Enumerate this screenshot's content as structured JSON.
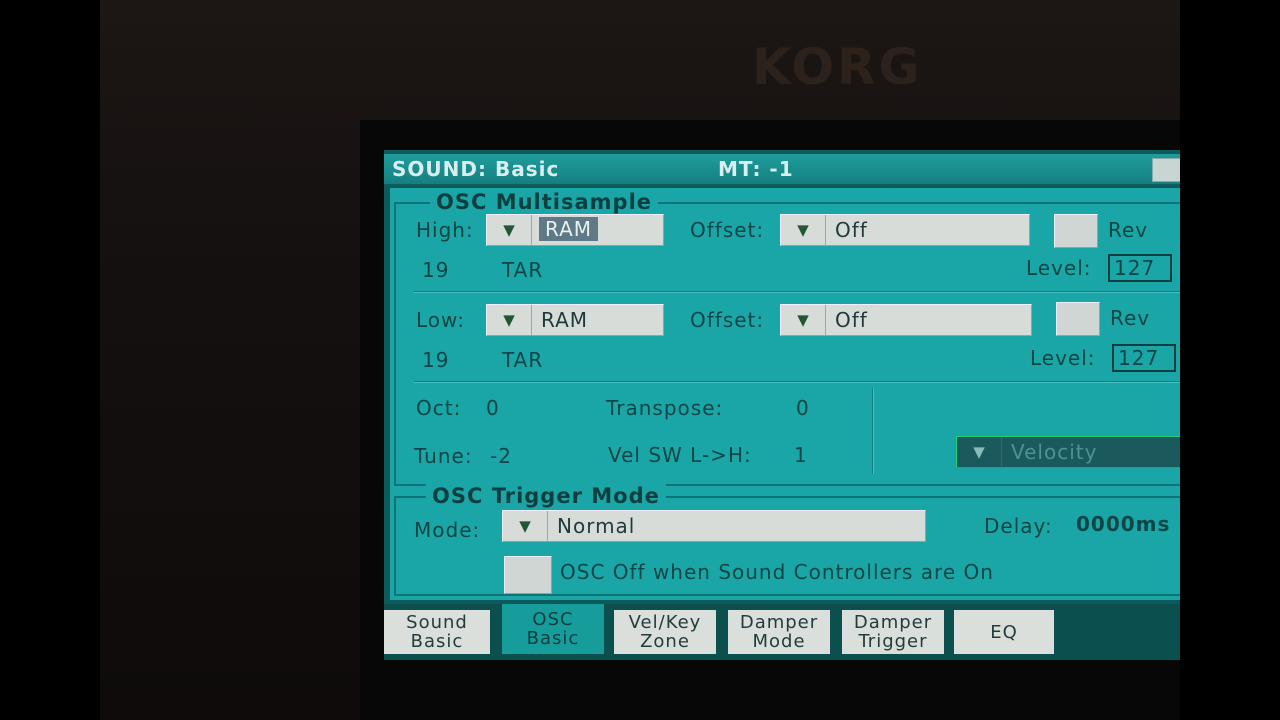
{
  "device": {
    "brand": "KORG"
  },
  "header": {
    "title": "SOUND: Basic",
    "mt": "MT: -1"
  },
  "osc_multisample": {
    "title": "OSC Multisample",
    "high": {
      "label": "High:",
      "bank": "RAM",
      "offset_label": "Offset:",
      "offset": "Off",
      "rev_label": "Rev",
      "number": "19",
      "name": "TAR",
      "level_label": "Level:",
      "level": "127"
    },
    "low": {
      "label": "Low:",
      "bank": "RAM",
      "offset_label": "Offset:",
      "offset": "Off",
      "rev_label": "Rev",
      "number": "19",
      "name": "TAR",
      "level_label": "Level:",
      "level": "127"
    },
    "oct_label": "Oct:",
    "oct": "0",
    "transpose_label": "Transpose:",
    "transpose": "0",
    "tune_label": "Tune:",
    "tune": "-2",
    "velsw_label": "Vel SW L->H:",
    "velsw": "1",
    "velocity": "Velocity"
  },
  "osc_trigger": {
    "title": "OSC Trigger Mode",
    "mode_label": "Mode:",
    "mode": "Normal",
    "delay_label": "Delay:",
    "delay": "0000ms",
    "osc_off_label": "OSC Off when Sound Controllers are On"
  },
  "tabs": [
    {
      "line1": "Sound",
      "line2": "Basic"
    },
    {
      "line1": "OSC",
      "line2": "Basic"
    },
    {
      "line1": "Vel/Key",
      "line2": "Zone"
    },
    {
      "line1": "Damper",
      "line2": "Mode"
    },
    {
      "line1": "Damper",
      "line2": "Trigger"
    },
    {
      "line1": "EQ",
      "line2": ""
    }
  ],
  "colors": {
    "screen_teal": "#1aa6a6",
    "titlebar": "#157f80",
    "button_face": "#dadfdb"
  }
}
